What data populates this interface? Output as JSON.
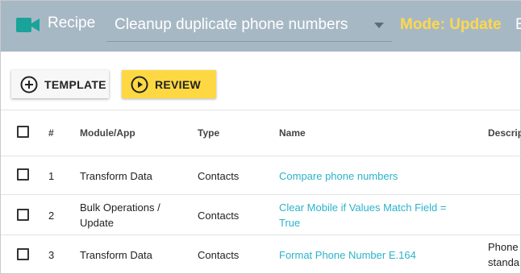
{
  "header": {
    "recipe_label": "Recipe",
    "recipe_select_value": "Cleanup duplicate phone numbers",
    "mode_label": "Mode: Update",
    "cut_text": "E",
    "icon": "video-camera-icon",
    "colors": {
      "header_bg": "#a7b8c5",
      "mode": "#ffd84d",
      "icon": "#1aa39a"
    }
  },
  "toolbar": {
    "template_label": "TEMPLATE",
    "review_label": "REVIEW",
    "template_icon": "plus-circle-icon",
    "review_icon": "play-circle-icon",
    "colors": {
      "review_bg": "#fdd843"
    }
  },
  "table": {
    "headers": {
      "index": "#",
      "module": "Module/App",
      "type": "Type",
      "name": "Name",
      "description": "Descrip"
    },
    "rows": [
      {
        "index": "1",
        "module": "Transform Data",
        "type": "Contacts",
        "name": "Compare phone numbers",
        "description": ""
      },
      {
        "index": "2",
        "module": "Bulk Operations / Update",
        "type": "Contacts",
        "name": "Clear Mobile if Values Match Field = True",
        "description": ""
      },
      {
        "index": "3",
        "module": "Transform Data",
        "type": "Contacts",
        "name": "Format Phone Number E.164",
        "description": "Phone standa"
      }
    ],
    "colors": {
      "link": "#2bb3c9"
    }
  }
}
